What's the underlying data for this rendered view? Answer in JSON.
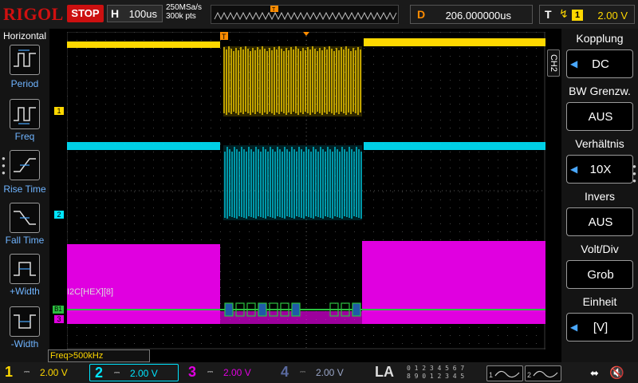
{
  "brand": "RIGOL",
  "run_state": "STOP",
  "horizontal": {
    "label": "H",
    "timebase": "100us",
    "sample_rate": "250MSa/s",
    "memory_depth": "300k pts"
  },
  "delay": {
    "label": "D",
    "value": "206.000000us"
  },
  "trigger": {
    "label": "T",
    "edge_icon": "rising-edge-icon",
    "source": "1",
    "level": "2.00 V"
  },
  "left_menu": {
    "title": "Horizontal",
    "items": [
      {
        "label": "Period",
        "icon": "period-icon"
      },
      {
        "label": "Freq",
        "icon": "freq-icon"
      },
      {
        "label": "Rise Time",
        "icon": "rise-time-icon"
      },
      {
        "label": "Fall Time",
        "icon": "fall-time-icon"
      },
      {
        "label": "+Width",
        "icon": "positive-width-icon"
      },
      {
        "label": "-Width",
        "icon": "negative-width-icon"
      }
    ]
  },
  "right_menu": {
    "channel_tab": "CH2",
    "items": [
      {
        "title": "Kopplung",
        "value": "DC",
        "has_arrow": true
      },
      {
        "title": "BW Grenzw.",
        "value": "AUS",
        "has_arrow": false
      },
      {
        "title": "Verhältnis",
        "value": "10X",
        "has_arrow": true
      },
      {
        "title": "Invers",
        "value": "AUS",
        "has_arrow": false
      },
      {
        "title": "Volt/Div",
        "value": "Grob",
        "has_arrow": false
      },
      {
        "title": "Einheit",
        "value": "[V]",
        "has_arrow": true
      }
    ]
  },
  "grid_markers": {
    "trigger_marker": "T",
    "ch1_marker": "1",
    "ch2_marker": "2",
    "bus_marker": "B1",
    "ch3_marker": "3",
    "bus_label": "I2C[HEX][8]"
  },
  "freq_info": "Freq>500kHz",
  "bottom": {
    "channels": [
      {
        "num": "1",
        "coupling": "DC",
        "scale": "2.00 V",
        "color": "#ffd800"
      },
      {
        "num": "2",
        "coupling": "DC",
        "scale": "2.00 V",
        "color": "#00e5ff"
      },
      {
        "num": "3",
        "coupling": "DC",
        "scale": "2.00 V",
        "color": "#e000e0"
      },
      {
        "num": "4",
        "coupling": "DC",
        "scale": "2.00 V",
        "color": "#5a6aa0"
      }
    ],
    "la_label": "LA",
    "la_bits_row1": "0 1 2 3   4 5 6 7",
    "la_bits_row2": "8 9 0 1   2 3 4 5",
    "gen1": "1",
    "gen2": "2"
  },
  "colors": {
    "ch1": "#ffd800",
    "ch2": "#00e5ff",
    "ch3": "#e000e0",
    "bus": "#2cc040",
    "trigger": "#ff8c00",
    "menu_accent": "#4aa8ff"
  }
}
